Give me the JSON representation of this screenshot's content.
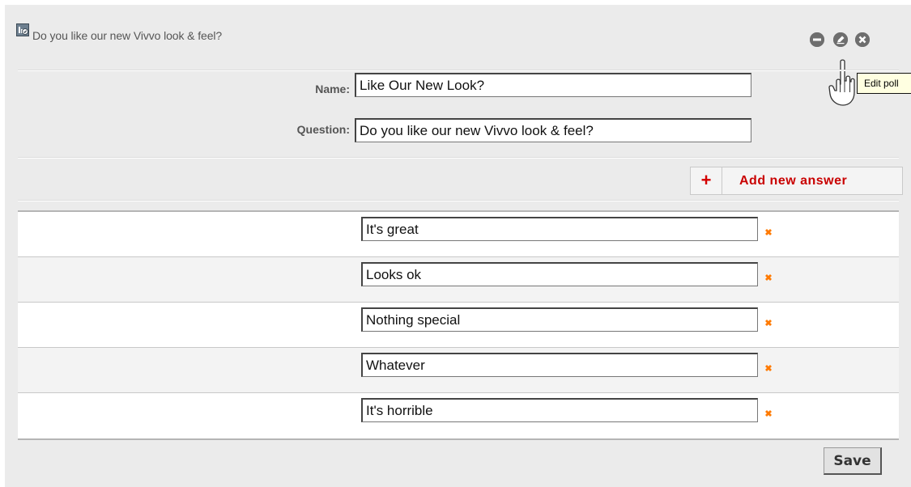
{
  "poll": {
    "header_title": "Do you like our new Vivvo look & feel?",
    "tooltip": "Edit poll"
  },
  "form": {
    "name_label": "Name:",
    "name_value": "Like Our New Look?",
    "question_label": "Question:",
    "question_value": "Do you like our new Vivvo look & feel?"
  },
  "add_answer": {
    "plus": "+",
    "label": "Add new answer"
  },
  "answers": [
    "It's great",
    "Looks ok",
    "Nothing special",
    "Whatever",
    "It's horrible"
  ],
  "save_label": "Save",
  "icons": {
    "poll": "poll-icon",
    "minimize": "minus-circle-icon",
    "edit": "edit-pencil-icon",
    "close": "close-circle-icon",
    "remove": "remove-x-icon",
    "cursor": "hand-pointer-icon"
  },
  "colors": {
    "panel_bg": "#ebebeb",
    "accent_red": "#c90000",
    "remove_orange": "#ff7a00"
  }
}
